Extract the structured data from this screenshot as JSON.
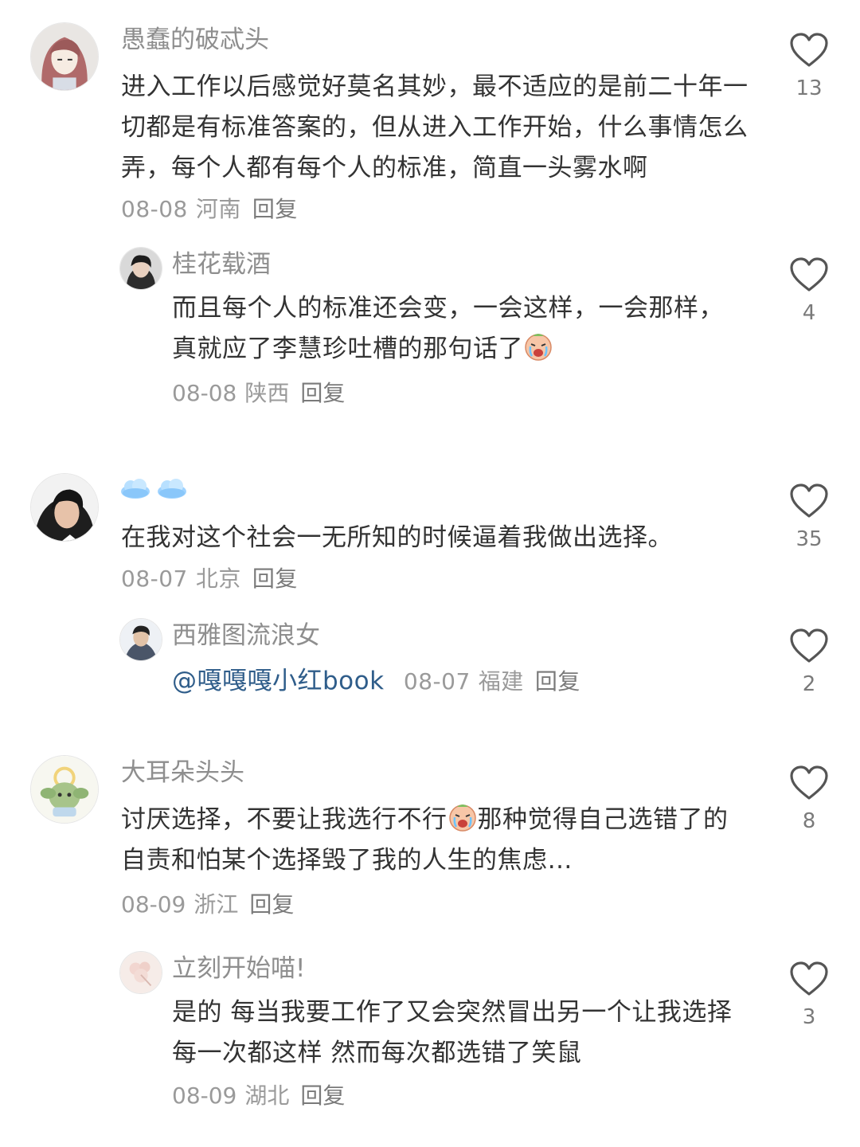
{
  "comments": [
    {
      "username": "愚蠢的破忒头",
      "text": "进入工作以后感觉好莫名其妙，最不适应的是前二十年一切都是有标准答案的，但从进入工作开始，什么事情怎么弄，每个人都有每个人的标准，简直一头雾水啊",
      "date": "08-08",
      "location": "河南",
      "reply_label": "回复",
      "likes": "13",
      "icons": {
        "like": "heart-icon"
      }
    },
    {
      "username": "桂花载酒",
      "text": "而且每个人的标准还会变，一会这样，一会那样，真就应了李慧珍吐槽的那句话了",
      "date": "08-08",
      "location": "陕西",
      "reply_label": "回复",
      "likes": "4",
      "icons": {
        "emoji": "crying-face-emoji",
        "like": "heart-icon"
      }
    },
    {
      "username_icons": [
        "cloud-icon",
        "cloud-icon"
      ],
      "text": "在我对这个社会一无所知的时候逼着我做出选择。",
      "date": "08-07",
      "location": "北京",
      "reply_label": "回复",
      "likes": "35",
      "icons": {
        "like": "heart-icon"
      }
    },
    {
      "username": "西雅图流浪女",
      "mention": "@嘎嘎嘎小红book",
      "date": "08-07",
      "location": "福建",
      "reply_label": "回复",
      "likes": "2",
      "icons": {
        "like": "heart-icon"
      }
    },
    {
      "username": "大耳朵头头",
      "text_before_emoji": "讨厌选择，不要让我选行不行",
      "text_after_emoji": "那种觉得自己选错了的自责和怕某个选择毁了我的人生的焦虑…",
      "date": "08-09",
      "location": "浙江",
      "reply_label": "回复",
      "likes": "8",
      "icons": {
        "emoji": "crying-face-emoji",
        "like": "heart-icon"
      }
    },
    {
      "username": "立刻开始喵!",
      "text": "是的 每当我要工作了又会突然冒出另一个让我选择 每一次都这样 然而每次都选错了笑鼠",
      "date": "08-09",
      "location": "湖北",
      "reply_label": "回复",
      "likes": "3",
      "icons": {
        "like": "heart-icon"
      }
    }
  ],
  "colors": {
    "username": "#8e8e8e",
    "text": "#333333",
    "meta": "#9a9a9a",
    "mention": "#2f5d8a"
  }
}
